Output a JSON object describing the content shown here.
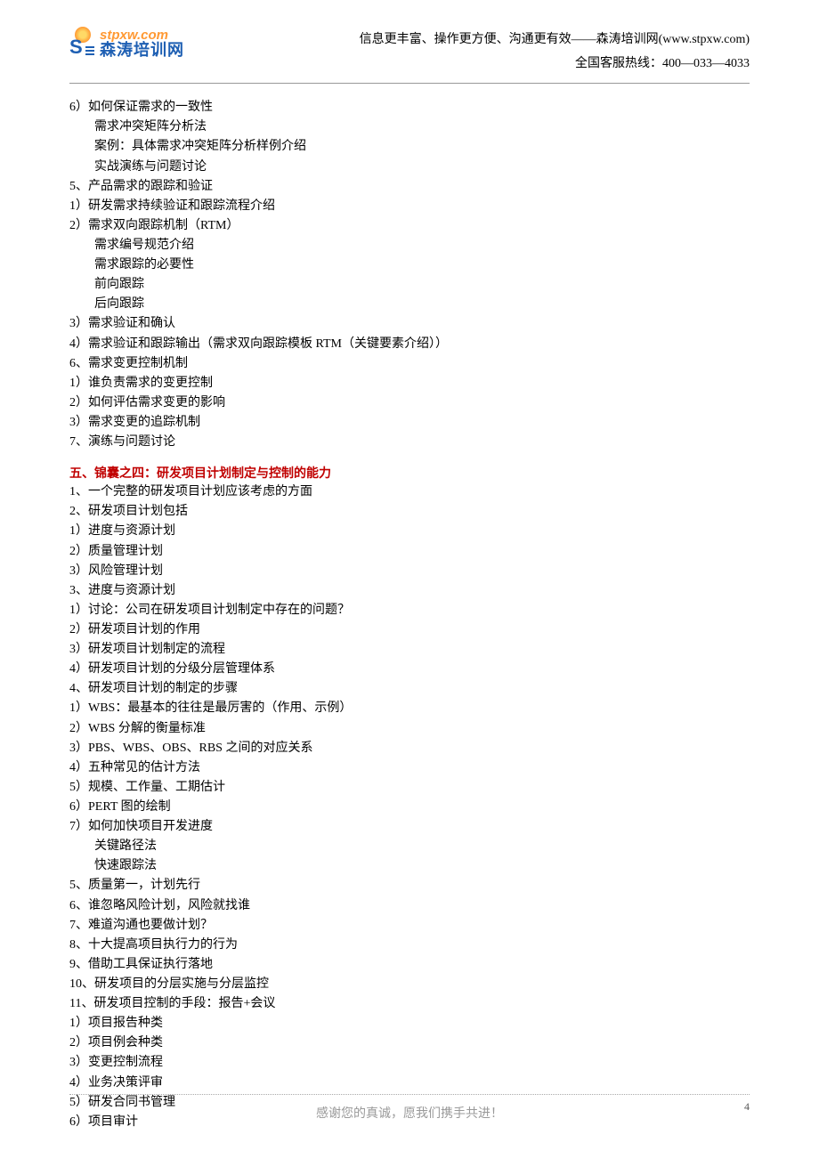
{
  "header": {
    "logo_url": "stpxw.com",
    "logo_cn": "森涛培训网",
    "tagline": "信息更丰富、操作更方便、沟通更有效——森涛培训网(www.stpxw.com)",
    "hotline": "全国客服热线：400—033—4033"
  },
  "body": {
    "lines": [
      {
        "t": "6）如何保证需求的一致性",
        "c": ""
      },
      {
        "t": "需求冲突矩阵分析法",
        "c": "indent"
      },
      {
        "t": "案例：具体需求冲突矩阵分析样例介绍",
        "c": "indent"
      },
      {
        "t": "实战演练与问题讨论",
        "c": "indent"
      },
      {
        "t": "5、产品需求的跟踪和验证",
        "c": ""
      },
      {
        "t": "1）研发需求持续验证和跟踪流程介绍",
        "c": ""
      },
      {
        "t": "2）需求双向跟踪机制（RTM）",
        "c": ""
      },
      {
        "t": "需求编号规范介绍",
        "c": "indent"
      },
      {
        "t": "需求跟踪的必要性",
        "c": "indent"
      },
      {
        "t": "前向跟踪",
        "c": "indent"
      },
      {
        "t": "后向跟踪",
        "c": "indent"
      },
      {
        "t": "3）需求验证和确认",
        "c": ""
      },
      {
        "t": "4）需求验证和跟踪输出（需求双向跟踪模板 RTM（关键要素介绍））",
        "c": ""
      },
      {
        "t": "6、需求变更控制机制",
        "c": ""
      },
      {
        "t": "1）谁负责需求的变更控制",
        "c": ""
      },
      {
        "t": "2）如何评估需求变更的影响",
        "c": ""
      },
      {
        "t": "3）需求变更的追踪机制",
        "c": ""
      },
      {
        "t": "7、演练与问题讨论",
        "c": ""
      }
    ],
    "section5_heading": "五、锦囊之四：研发项目计划制定与控制的能力",
    "section5_lines": [
      {
        "t": "1、一个完整的研发项目计划应该考虑的方面",
        "c": ""
      },
      {
        "t": "2、研发项目计划包括",
        "c": ""
      },
      {
        "t": "1）进度与资源计划",
        "c": ""
      },
      {
        "t": "2）质量管理计划",
        "c": ""
      },
      {
        "t": "3）风险管理计划",
        "c": ""
      },
      {
        "t": "3、进度与资源计划",
        "c": ""
      },
      {
        "t": "1）讨论：公司在研发项目计划制定中存在的问题？",
        "c": ""
      },
      {
        "t": "2）研发项目计划的作用",
        "c": ""
      },
      {
        "t": "3）研发项目计划制定的流程",
        "c": ""
      },
      {
        "t": "4）研发项目计划的分级分层管理体系",
        "c": ""
      },
      {
        "t": "4、研发项目计划的制定的步骤",
        "c": ""
      },
      {
        "t": "1）WBS：最基本的往往是最厉害的（作用、示例）",
        "c": ""
      },
      {
        "t": "2）WBS 分解的衡量标准",
        "c": ""
      },
      {
        "t": "3）PBS、WBS、OBS、RBS 之间的对应关系",
        "c": ""
      },
      {
        "t": "4）五种常见的估计方法",
        "c": ""
      },
      {
        "t": "5）规模、工作量、工期估计",
        "c": ""
      },
      {
        "t": "6）PERT 图的绘制",
        "c": ""
      },
      {
        "t": "7）如何加快项目开发进度",
        "c": ""
      },
      {
        "t": "关键路径法",
        "c": "indent"
      },
      {
        "t": "快速跟踪法",
        "c": "indent"
      },
      {
        "t": "5、质量第一，计划先行",
        "c": ""
      },
      {
        "t": "6、谁忽略风险计划，风险就找谁",
        "c": ""
      },
      {
        "t": "7、难道沟通也要做计划？",
        "c": ""
      },
      {
        "t": "8、十大提高项目执行力的行为",
        "c": ""
      },
      {
        "t": "9、借助工具保证执行落地",
        "c": ""
      },
      {
        "t": "10、研发项目的分层实施与分层监控",
        "c": ""
      },
      {
        "t": "11、研发项目控制的手段：报告+会议",
        "c": ""
      },
      {
        "t": "1）项目报告种类",
        "c": ""
      },
      {
        "t": "2）项目例会种类",
        "c": ""
      },
      {
        "t": "3）变更控制流程",
        "c": ""
      },
      {
        "t": "4）业务决策评审",
        "c": ""
      },
      {
        "t": "5）研发合同书管理",
        "c": ""
      },
      {
        "t": "6）项目审计",
        "c": ""
      }
    ]
  },
  "footer": {
    "text": "感谢您的真诚，愿我们携手共进！",
    "page_num": "4"
  }
}
